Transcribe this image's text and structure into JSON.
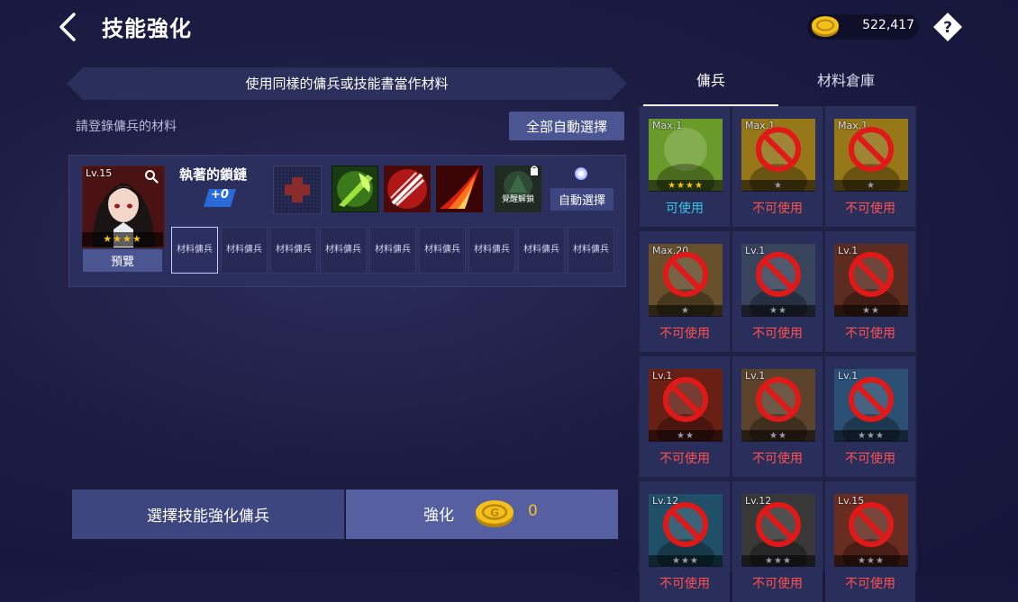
{
  "header": {
    "title": "技能強化",
    "gold": "522,417"
  },
  "banner": "使用同樣的傭兵或技能書當作材料",
  "register_label": "請登錄傭兵的材料",
  "auto_all_button": "全部自動選擇",
  "hero": {
    "level": "Lv.15",
    "stars": "★★★★",
    "preview_button": "預覽",
    "skill_name": "執著的鎖鏈",
    "skill_plus": "+0"
  },
  "skill_slots": [
    {
      "name": "empty-cross"
    },
    {
      "name": "green-axe"
    },
    {
      "name": "red-spear"
    },
    {
      "name": "flame-strike"
    },
    {
      "name": "locked",
      "label": "覺醒解鎖"
    }
  ],
  "auto_select_button": "自動選擇",
  "material_slot_label": "材料傭兵",
  "material_slot_count": 9,
  "bottom": {
    "choose_button": "選擇技能強化傭兵",
    "enhance_label": "強化",
    "enhance_cost": "0"
  },
  "tabs": [
    {
      "label": "傭兵",
      "active": true
    },
    {
      "label": "材料倉庫",
      "active": false
    }
  ],
  "cards": [
    {
      "lv": "Max.1",
      "stars": "★★★★",
      "status": "可使用",
      "usable": true,
      "color": "#6a9a2a"
    },
    {
      "lv": "Max.1",
      "stars": "★",
      "status": "不可使用",
      "usable": false,
      "color": "#c9a020"
    },
    {
      "lv": "Max.1",
      "stars": "★",
      "status": "不可使用",
      "usable": false,
      "color": "#c9a020"
    },
    {
      "lv": "Max.20",
      "stars": "★",
      "status": "不可使用",
      "usable": false,
      "color": "#8a6a3a"
    },
    {
      "lv": "Lv.1",
      "stars": "★★",
      "status": "不可使用",
      "usable": false,
      "color": "#4a5a7a"
    },
    {
      "lv": "Lv.1",
      "stars": "★★",
      "status": "不可使用",
      "usable": false,
      "color": "#7a3a2a"
    },
    {
      "lv": "Lv.1",
      "stars": "★★",
      "status": "不可使用",
      "usable": false,
      "color": "#8a2a1a"
    },
    {
      "lv": "Lv.1",
      "stars": "★★",
      "status": "不可使用",
      "usable": false,
      "color": "#7a5a3a"
    },
    {
      "lv": "Lv.1",
      "stars": "★★★",
      "status": "不可使用",
      "usable": false,
      "color": "#3a6a9a"
    },
    {
      "lv": "Lv.12",
      "stars": "★★★",
      "status": "不可使用",
      "usable": false,
      "color": "#2a6a8a"
    },
    {
      "lv": "Lv.12",
      "stars": "★★★",
      "status": "不可使用",
      "usable": false,
      "color": "#4a4a4a"
    },
    {
      "lv": "Lv.15",
      "stars": "★★★",
      "status": "不可使用",
      "usable": false,
      "color": "#8a3a2a"
    }
  ],
  "colors": {
    "usable": "#36c8e8",
    "unusable": "#ff5050",
    "star_gold": "#f4c01c",
    "star_grey": "#9a9aa8"
  }
}
